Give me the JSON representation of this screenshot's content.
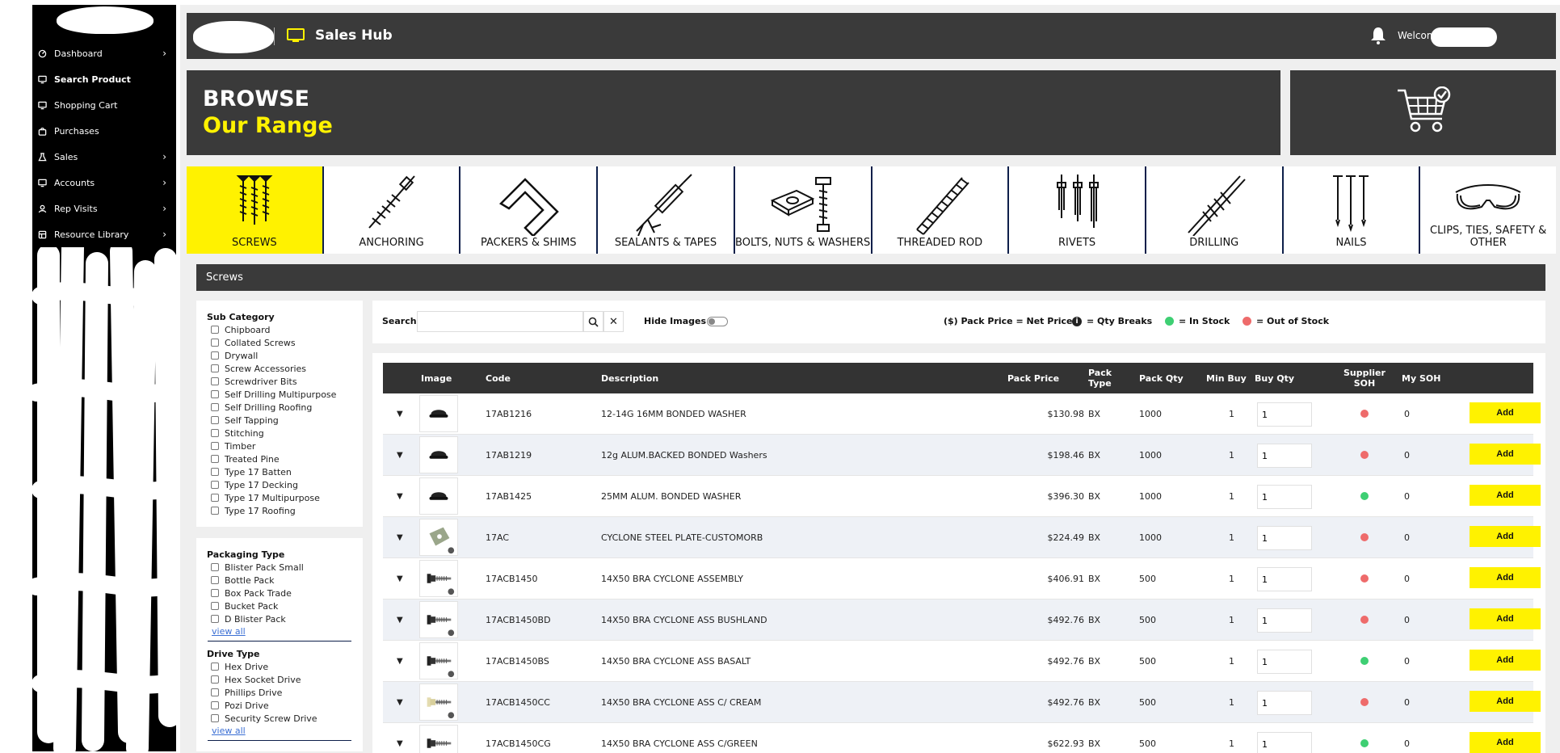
{
  "sidebar": {
    "items": [
      {
        "label": "Dashboard",
        "icon": "dashboard-icon",
        "chevron": true
      },
      {
        "label": "Search Product",
        "icon": "monitor-icon",
        "chevron": false
      },
      {
        "label": "Shopping Cart",
        "icon": "monitor-icon",
        "chevron": false
      },
      {
        "label": "Purchases",
        "icon": "bag-icon",
        "chevron": false
      },
      {
        "label": "Sales",
        "icon": "flask-icon",
        "chevron": true
      },
      {
        "label": "Accounts",
        "icon": "monitor-icon",
        "chevron": true
      },
      {
        "label": "Rep Visits",
        "icon": "user-icon",
        "chevron": true
      },
      {
        "label": "Resource Library",
        "icon": "box-icon",
        "chevron": true
      }
    ]
  },
  "header": {
    "title": "Sales Hub",
    "welcome": "Welcom"
  },
  "banner": {
    "line1": "BROWSE",
    "line2": "Our Range"
  },
  "categories": [
    {
      "label": "SCREWS",
      "icon": "screws-icon",
      "active": true
    },
    {
      "label": "ANCHORING",
      "icon": "anchor-bolt-icon",
      "active": false
    },
    {
      "label": "PACKERS & SHIMS",
      "icon": "shim-icon",
      "active": false
    },
    {
      "label": "SEALANTS & TAPES",
      "icon": "caulking-gun-icon",
      "active": false
    },
    {
      "label": "BOLTS, NUTS & WASHERS",
      "icon": "bolt-nut-icon",
      "active": false
    },
    {
      "label": "THREADED ROD",
      "icon": "threaded-rod-icon",
      "active": false
    },
    {
      "label": "RIVETS",
      "icon": "rivets-icon",
      "active": false
    },
    {
      "label": "DRILLING",
      "icon": "drill-bit-icon",
      "active": false
    },
    {
      "label": "NAILS",
      "icon": "nails-icon",
      "active": false
    },
    {
      "label_line1": "CLIPS, TIES, SAFETY &",
      "label_line2": "OTHER",
      "icon": "safety-glasses-icon",
      "active": false
    }
  ],
  "section_title": "Screws",
  "filters": {
    "sub_category": {
      "title": "Sub Category",
      "options": [
        "Chipboard",
        "Collated Screws",
        "Drywall",
        "Screw Accessories",
        "Screwdriver Bits",
        "Self Drilling Multipurpose",
        "Self Drilling Roofing",
        "Self Tapping",
        "Stitching",
        "Timber",
        "Treated Pine",
        "Type 17 Batten",
        "Type 17 Decking",
        "Type 17 Multipurpose",
        "Type 17 Roofing"
      ]
    },
    "packaging_type": {
      "title": "Packaging Type",
      "options": [
        "Blister Pack Small",
        "Bottle Pack",
        "Box Pack Trade",
        "Bucket Pack",
        "D Blister Pack"
      ],
      "view_all": "view all"
    },
    "drive_type": {
      "title": "Drive Type",
      "options": [
        "Hex Drive",
        "Hex Socket Drive",
        "Phillips Drive",
        "Pozi Drive",
        "Security Screw Drive"
      ],
      "view_all": "view all"
    }
  },
  "search": {
    "label": "Search",
    "value": "",
    "placeholder": "",
    "hide_images_label": "Hide Images",
    "hide_images_on": false
  },
  "legend": {
    "net_price": "($) Pack Price = Net Price",
    "qty_breaks": "= Qty Breaks",
    "in_stock": "= In Stock",
    "out_of_stock": "= Out of Stock",
    "in_stock_color": "#3ecf73",
    "out_of_stock_color": "#ee6b6b"
  },
  "table": {
    "headers": {
      "image": "Image",
      "code": "Code",
      "description": "Description",
      "pack_price": "Pack Price",
      "pack_type_1": "Pack",
      "pack_type_2": "Type",
      "pack_qty": "Pack Qty",
      "min_buy": "Min Buy",
      "buy_qty": "Buy Qty",
      "supplier_soh_1": "Supplier",
      "supplier_soh_2": "SOH",
      "my_soh": "My SOH"
    },
    "add_label": "Add",
    "rows": [
      {
        "code": "17AB1216",
        "description": "12-14G 16MM BONDED WASHER",
        "price": "$130.98",
        "pack_type": "BX",
        "pack_qty": "1000",
        "min_buy": "1",
        "buy_qty": "1",
        "in_stock": false,
        "my_soh": "0",
        "thumb": "washer"
      },
      {
        "code": "17AB1219",
        "description": "12g ALUM.BACKED BONDED Washers",
        "price": "$198.46",
        "pack_type": "BX",
        "pack_qty": "1000",
        "min_buy": "1",
        "buy_qty": "1",
        "in_stock": false,
        "my_soh": "0",
        "thumb": "washer"
      },
      {
        "code": "17AB1425",
        "description": "25MM ALUM. BONDED WASHER",
        "price": "$396.30",
        "pack_type": "BX",
        "pack_qty": "1000",
        "min_buy": "1",
        "buy_qty": "1",
        "in_stock": true,
        "my_soh": "0",
        "thumb": "washer"
      },
      {
        "code": "17AC",
        "description": "CYCLONE STEEL PLATE-CUSTOMORB",
        "price": "$224.49",
        "pack_type": "BX",
        "pack_qty": "1000",
        "min_buy": "1",
        "buy_qty": "1",
        "in_stock": false,
        "my_soh": "0",
        "thumb": "plate"
      },
      {
        "code": "17ACB1450",
        "description": "14X50 BRA CYCLONE ASSEMBLY",
        "price": "$406.91",
        "pack_type": "BX",
        "pack_qty": "500",
        "min_buy": "1",
        "buy_qty": "1",
        "in_stock": false,
        "my_soh": "0",
        "thumb": "screw"
      },
      {
        "code": "17ACB1450BD",
        "description": "14X50 BRA CYCLONE ASS BUSHLAND",
        "price": "$492.76",
        "pack_type": "BX",
        "pack_qty": "500",
        "min_buy": "1",
        "buy_qty": "1",
        "in_stock": false,
        "my_soh": "0",
        "thumb": "screw"
      },
      {
        "code": "17ACB1450BS",
        "description": "14X50 BRA CYCLONE ASS BASALT",
        "price": "$492.76",
        "pack_type": "BX",
        "pack_qty": "500",
        "min_buy": "1",
        "buy_qty": "1",
        "in_stock": true,
        "my_soh": "0",
        "thumb": "screw"
      },
      {
        "code": "17ACB1450CC",
        "description": "14X50 BRA CYCLONE ASS C/ CREAM",
        "price": "$492.76",
        "pack_type": "BX",
        "pack_qty": "500",
        "min_buy": "1",
        "buy_qty": "1",
        "in_stock": false,
        "my_soh": "0",
        "thumb": "screw-cream"
      },
      {
        "code": "17ACB1450CG",
        "description": "14X50 BRA CYCLONE ASS C/GREEN",
        "price": "$622.93",
        "pack_type": "BX",
        "pack_qty": "500",
        "min_buy": "1",
        "buy_qty": "1",
        "in_stock": true,
        "my_soh": "0",
        "thumb": "screw"
      }
    ]
  }
}
